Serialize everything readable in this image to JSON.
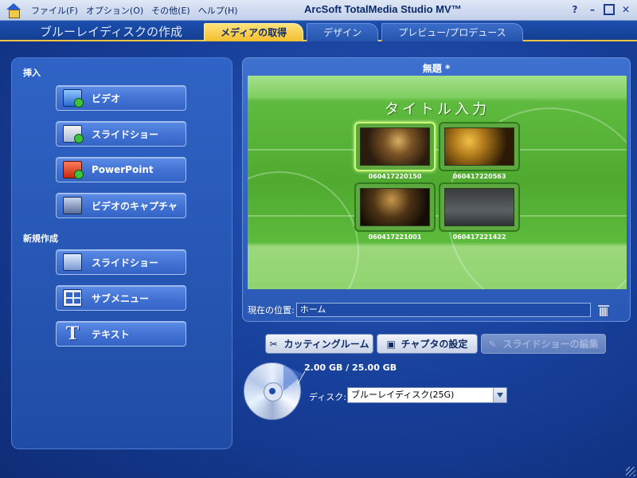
{
  "titlebar": {
    "menu": [
      "ファイル(F)",
      "オプション(O)",
      "その他(E)",
      "ヘルプ(H)"
    ],
    "app_title": "ArcSoft TotalMedia Studio MV™",
    "controls": {
      "help": "?",
      "minimize": "–",
      "close": "✕"
    }
  },
  "header": {
    "page_title": "ブルーレイディスクの作成",
    "tabs": [
      "メディアの取得",
      "デザイン",
      "プレビュー/プロデュース"
    ],
    "active_tab": "メディアの取得"
  },
  "left_panel": {
    "insert_label": "挿入",
    "insert_buttons": [
      "ビデオ",
      "スライドショー",
      "PowerPoint",
      "ビデオのキャプチャ"
    ],
    "new_label": "新規作成",
    "new_buttons": [
      "スライドショー",
      "サブメニュー",
      "テキスト"
    ],
    "text_icon_glyph": "T"
  },
  "preview": {
    "title": "無題 *",
    "menu_title": "タイトル入力",
    "thumbnails": [
      "060417220150",
      "060417220563",
      "060417221001",
      "060417221422"
    ],
    "location_label": "現在の位置:",
    "location_value": "ホーム"
  },
  "actions": {
    "cutting_room": "カッティングルーム",
    "chapter_settings": "チャプタの設定",
    "edit_slideshow": "スライドショーの編集"
  },
  "disc": {
    "capacity": "2.00 GB / 25.00 GB",
    "label": "ディスク:",
    "selected": "ブルーレイディスク(25G)"
  },
  "colors": {
    "accent_yellow": "#f2be2d",
    "panel_blue": "#2f63c5",
    "preview_green": "#5fbb3f"
  }
}
